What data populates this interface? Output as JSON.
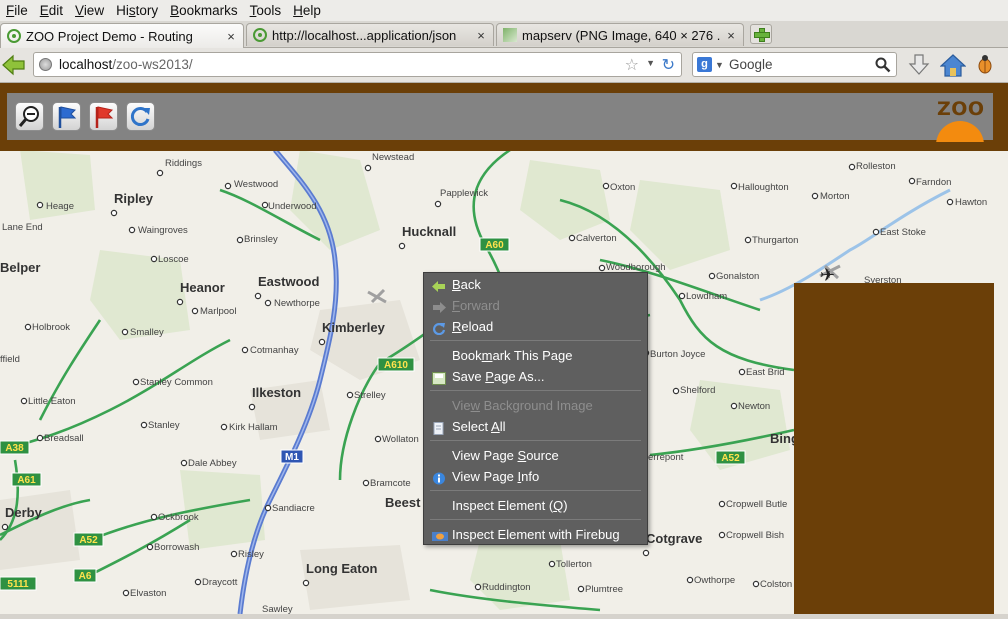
{
  "menubar": [
    {
      "pre": "",
      "key": "F",
      "post": "ile"
    },
    {
      "pre": "",
      "key": "E",
      "post": "dit"
    },
    {
      "pre": "",
      "key": "V",
      "post": "iew"
    },
    {
      "pre": "Hi",
      "key": "s",
      "post": "tory"
    },
    {
      "pre": "",
      "key": "B",
      "post": "ookmarks"
    },
    {
      "pre": "",
      "key": "T",
      "post": "ools"
    },
    {
      "pre": "",
      "key": "H",
      "post": "elp"
    }
  ],
  "tabs": [
    {
      "label": "ZOO Project Demo - Routing",
      "close": "×"
    },
    {
      "label": "http://localhost...application/json",
      "close": "×"
    },
    {
      "label": "mapserv (PNG Image, 640 × 276 ...",
      "close": "×"
    }
  ],
  "nav": {
    "url_host": "localhost",
    "url_path": "/zoo-ws2013/",
    "search_placeholder": "Google",
    "search_engine_icon": "g"
  },
  "logo_text": "ZOO",
  "map": {
    "towns": [
      {
        "name": "Ripley",
        "bold": true
      },
      {
        "name": "Hucknall",
        "bold": true
      },
      {
        "name": "Heanor",
        "bold": true
      },
      {
        "name": "Eastwood",
        "bold": true
      },
      {
        "name": "Kimberley",
        "bold": true
      },
      {
        "name": "Ilkeston",
        "bold": true
      },
      {
        "name": "Derby",
        "bold": true
      },
      {
        "name": "Long Eaton",
        "bold": true
      },
      {
        "name": "Cotgrave",
        "bold": true
      },
      {
        "name": "Belper",
        "bold": true
      },
      {
        "name": "Beest",
        "bold": true
      },
      {
        "name": "Bing",
        "bold": true
      },
      {
        "name": "Riddings",
        "bold": false
      },
      {
        "name": "Westwood",
        "bold": false
      },
      {
        "name": "Newstead",
        "bold": false
      },
      {
        "name": "Papplewick",
        "bold": false
      },
      {
        "name": "Oxton",
        "bold": false
      },
      {
        "name": "Halloughton",
        "bold": false
      },
      {
        "name": "Rolleston",
        "bold": false
      },
      {
        "name": "Farndon",
        "bold": false
      },
      {
        "name": "Heage",
        "bold": false
      },
      {
        "name": "Underwood",
        "bold": false
      },
      {
        "name": "Morton",
        "bold": false
      },
      {
        "name": "Hawton",
        "bold": false
      },
      {
        "name": "Lane End",
        "bold": false
      },
      {
        "name": "Waingroves",
        "bold": false
      },
      {
        "name": "Brinsley",
        "bold": false
      },
      {
        "name": "Calverton",
        "bold": false
      },
      {
        "name": "Thurgarton",
        "bold": false
      },
      {
        "name": "East Stoke",
        "bold": false
      },
      {
        "name": "Loscoe",
        "bold": false
      },
      {
        "name": "Woodborough",
        "bold": false
      },
      {
        "name": "Gonalston",
        "bold": false
      },
      {
        "name": "Syerston",
        "bold": false
      },
      {
        "name": "Newthorpe",
        "bold": false
      },
      {
        "name": "Lowdham",
        "bold": false
      },
      {
        "name": "Marlpool",
        "bold": false
      },
      {
        "name": "Holbrook",
        "bold": false
      },
      {
        "name": "Smalley",
        "bold": false
      },
      {
        "name": "Cotmanhay",
        "bold": false
      },
      {
        "name": "Burton Joyce",
        "bold": false
      },
      {
        "name": "ffield",
        "bold": false
      },
      {
        "name": "Stanley Common",
        "bold": false
      },
      {
        "name": "Strelley",
        "bold": false
      },
      {
        "name": "Shelford",
        "bold": false
      },
      {
        "name": "East Brid",
        "bold": false
      },
      {
        "name": "Little Eaton",
        "bold": false
      },
      {
        "name": "Newton",
        "bold": false
      },
      {
        "name": "Stanley",
        "bold": false
      },
      {
        "name": "Kirk Hallam",
        "bold": false
      },
      {
        "name": "Breadsall",
        "bold": false
      },
      {
        "name": "Wollaton",
        "bold": false
      },
      {
        "name": "Dale Abbey",
        "bold": false
      },
      {
        "name": "Bramcote",
        "bold": false
      },
      {
        "name": "Cropwell Butle",
        "bold": false
      },
      {
        "name": "Ockbrook",
        "bold": false
      },
      {
        "name": "Sandiacre",
        "bold": false
      },
      {
        "name": "Borrowash",
        "bold": false
      },
      {
        "name": "Risley",
        "bold": false
      },
      {
        "name": "Cropwell Bish",
        "bold": false
      },
      {
        "name": "Tollerton",
        "bold": false
      },
      {
        "name": "Draycott",
        "bold": false
      },
      {
        "name": "Plumtree",
        "bold": false
      },
      {
        "name": "Elvaston",
        "bold": false
      },
      {
        "name": "Owthorpe",
        "bold": false
      },
      {
        "name": "Colston",
        "bold": false
      },
      {
        "name": "Ruddington",
        "bold": false
      },
      {
        "name": "Sawley",
        "bold": false
      },
      {
        "name": "errepont",
        "bold": false
      }
    ],
    "roads": [
      "A60",
      "A610",
      "M1",
      "A38",
      "A61",
      "A52",
      "A52",
      "A6",
      "5111"
    ]
  },
  "context_menu": [
    {
      "type": "item",
      "pre": "",
      "key": "B",
      "post": "ack",
      "icon": "back-arrow-icon",
      "enabled": true
    },
    {
      "type": "item",
      "pre": "",
      "key": "F",
      "post": "orward",
      "icon": "forward-arrow-icon",
      "enabled": false
    },
    {
      "type": "item",
      "pre": "",
      "key": "R",
      "post": "eload",
      "icon": "reload-icon",
      "enabled": true
    },
    {
      "type": "sep"
    },
    {
      "type": "item",
      "pre": "Book",
      "key": "m",
      "post": "ark This Page",
      "icon": "",
      "enabled": true
    },
    {
      "type": "item",
      "pre": "Save ",
      "key": "P",
      "post": "age As...",
      "icon": "save-page-icon",
      "enabled": true
    },
    {
      "type": "sep"
    },
    {
      "type": "item",
      "pre": "Vie",
      "key": "w",
      "post": " Background Image",
      "icon": "",
      "enabled": false
    },
    {
      "type": "item",
      "pre": "Select ",
      "key": "A",
      "post": "ll",
      "icon": "select-all-icon",
      "enabled": true
    },
    {
      "type": "sep"
    },
    {
      "type": "item",
      "pre": "View Page ",
      "key": "S",
      "post": "ource",
      "icon": "",
      "enabled": true
    },
    {
      "type": "item",
      "pre": "View Page ",
      "key": "I",
      "post": "nfo",
      "icon": "info-icon",
      "enabled": true
    },
    {
      "type": "sep"
    },
    {
      "type": "item",
      "pre": "Inspect Element (",
      "key": "Q",
      "post": ")",
      "icon": "",
      "enabled": true
    },
    {
      "type": "sep"
    },
    {
      "type": "item",
      "pre": "Inspect Element with Firebug",
      "key": "",
      "post": "",
      "icon": "firebug-icon",
      "enabled": true
    }
  ]
}
